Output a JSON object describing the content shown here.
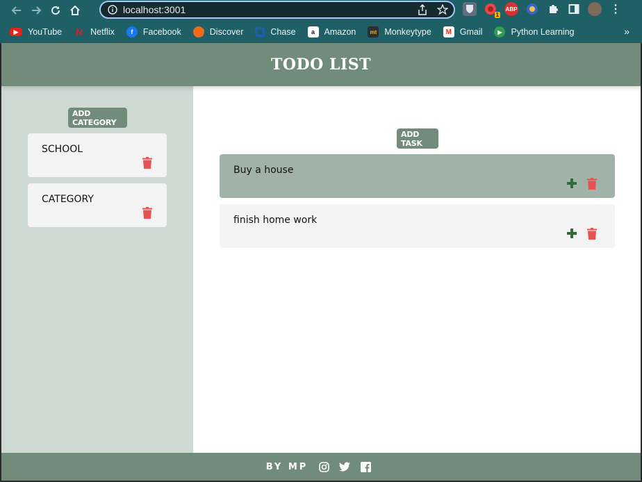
{
  "browser": {
    "url": "localhost:3001",
    "bookmarks": [
      {
        "label": "YouTube",
        "icon": "youtube-icon",
        "color": "#e62117"
      },
      {
        "label": "Netflix",
        "icon": "netflix-icon",
        "color": "#b20710"
      },
      {
        "label": "Facebook",
        "icon": "facebook-icon",
        "color": "#1877f2"
      },
      {
        "label": "Discover",
        "icon": "discover-icon",
        "color": "#f06a1c"
      },
      {
        "label": "Chase",
        "icon": "chase-icon",
        "color": "#1a5fb4"
      },
      {
        "label": "Amazon",
        "icon": "amazon-icon",
        "color": "#ffffff"
      },
      {
        "label": "Monkeytype",
        "icon": "monkeytype-icon",
        "color": "#2c2e31"
      },
      {
        "label": "Gmail",
        "icon": "gmail-icon",
        "color": "#ffffff"
      },
      {
        "label": "Python Learning",
        "icon": "python-learning-icon",
        "color": "#2e9e4f"
      }
    ],
    "more_label": "»",
    "extension_badge": "1",
    "abp_label": "ABP"
  },
  "app": {
    "title": "TODO LIST",
    "add_category_label": "ADD CATEGORY",
    "add_task_label": "ADD TASK",
    "categories": [
      {
        "label": "SCHOOL"
      },
      {
        "label": "CATEGORY"
      }
    ],
    "tasks": [
      {
        "label": "Buy a house",
        "active": true
      },
      {
        "label": "finish home work",
        "active": false
      }
    ],
    "footer_text": "BY MP"
  },
  "colors": {
    "primary": "#728c7b",
    "sidebar": "#cfd9d4",
    "active_task": "#a1b3a8",
    "trash": "#e55353",
    "plus": "#2f6b3a"
  }
}
